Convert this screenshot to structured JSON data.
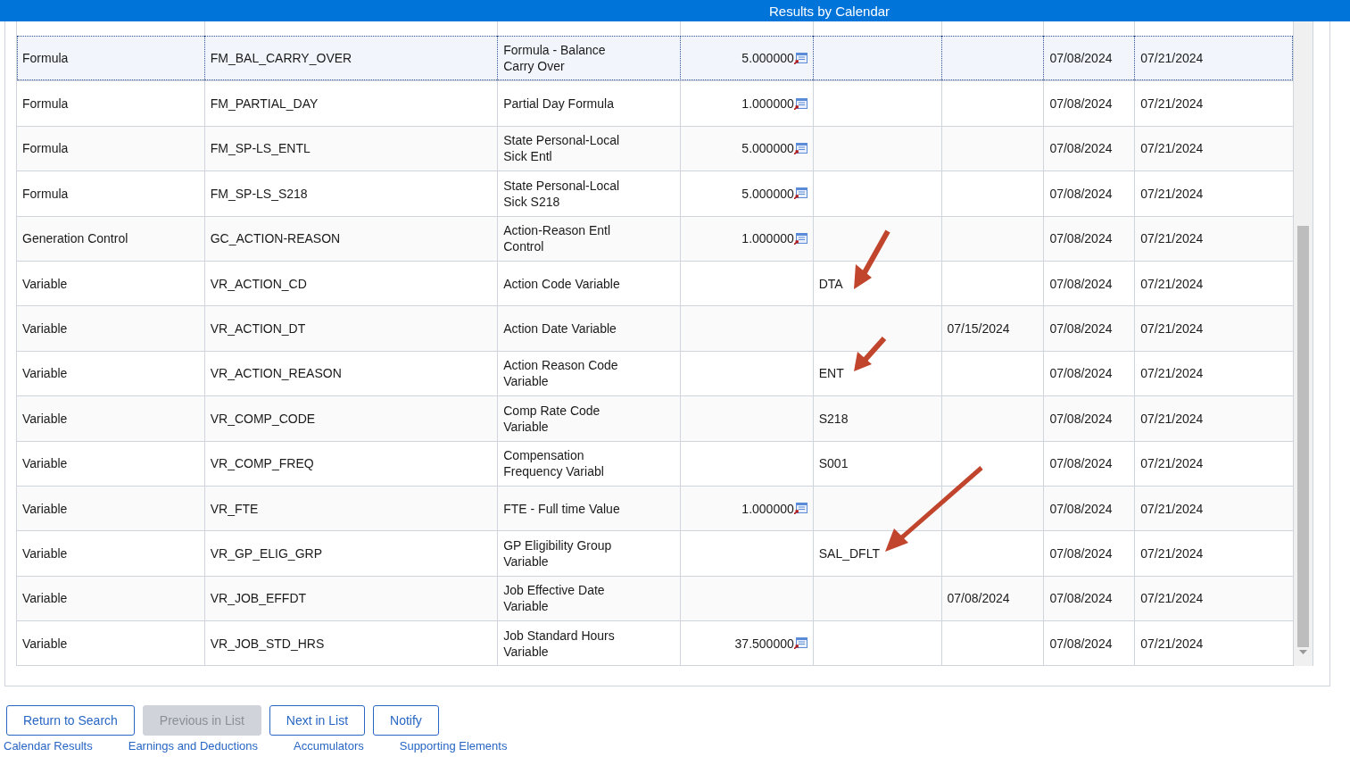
{
  "header": {
    "title": "Results by Calendar"
  },
  "rows": [
    {
      "selected": true,
      "cells": [
        "Formula",
        "FM_BAL_CARRY_OVER",
        "Formula - Balance Carry Over",
        "5.000000",
        "",
        "",
        "07/08/2024",
        "07/21/2024"
      ]
    },
    {
      "selected": false,
      "cells": [
        "Formula",
        "FM_PARTIAL_DAY",
        "Partial Day Formula",
        "1.000000",
        "",
        "",
        "07/08/2024",
        "07/21/2024"
      ]
    },
    {
      "selected": false,
      "cells": [
        "Formula",
        "FM_SP-LS_ENTL",
        "State Personal-Local Sick Entl",
        "5.000000",
        "",
        "",
        "07/08/2024",
        "07/21/2024"
      ]
    },
    {
      "selected": false,
      "cells": [
        "Formula",
        "FM_SP-LS_S218",
        "State Personal-Local Sick S218",
        "5.000000",
        "",
        "",
        "07/08/2024",
        "07/21/2024"
      ]
    },
    {
      "selected": false,
      "cells": [
        "Generation Control",
        "GC_ACTION-REASON",
        "Action-Reason Entl Control",
        "1.000000",
        "",
        "",
        "07/08/2024",
        "07/21/2024"
      ]
    },
    {
      "selected": false,
      "cells": [
        "Variable",
        "VR_ACTION_CD",
        "Action Code Variable",
        "",
        "DTA",
        "",
        "07/08/2024",
        "07/21/2024"
      ]
    },
    {
      "selected": false,
      "cells": [
        "Variable",
        "VR_ACTION_DT",
        "Action Date Variable",
        "",
        "",
        "07/15/2024",
        "07/08/2024",
        "07/21/2024"
      ]
    },
    {
      "selected": false,
      "cells": [
        "Variable",
        "VR_ACTION_REASON",
        "Action Reason Code Variable",
        "",
        "ENT",
        "",
        "07/08/2024",
        "07/21/2024"
      ]
    },
    {
      "selected": false,
      "cells": [
        "Variable",
        "VR_COMP_CODE",
        "Comp Rate Code Variable",
        "",
        "S218",
        "",
        "07/08/2024",
        "07/21/2024"
      ]
    },
    {
      "selected": false,
      "cells": [
        "Variable",
        "VR_COMP_FREQ",
        "Compensation Frequency Variabl",
        "",
        "S001",
        "",
        "07/08/2024",
        "07/21/2024"
      ]
    },
    {
      "selected": false,
      "cells": [
        "Variable",
        "VR_FTE",
        "FTE - Full time Value",
        "1.000000",
        "",
        "",
        "07/08/2024",
        "07/21/2024"
      ]
    },
    {
      "selected": false,
      "cells": [
        "Variable",
        "VR_GP_ELIG_GRP",
        "GP Eligibility Group Variable",
        "",
        "SAL_DFLT",
        "",
        "07/08/2024",
        "07/21/2024"
      ]
    },
    {
      "selected": false,
      "cells": [
        "Variable",
        "VR_JOB_EFFDT",
        "Job Effective Date Variable",
        "",
        "",
        "07/08/2024",
        "07/08/2024",
        "07/21/2024"
      ]
    },
    {
      "selected": false,
      "cells": [
        "Variable",
        "VR_JOB_STD_HRS",
        "Job Standard Hours Variable",
        "37.500000",
        "",
        "",
        "07/08/2024",
        "07/21/2024"
      ]
    }
  ],
  "buttons": [
    {
      "label": "Return to Search",
      "disabled": false
    },
    {
      "label": "Previous in List",
      "disabled": true
    },
    {
      "label": "Next in List",
      "disabled": false
    },
    {
      "label": "Notify",
      "disabled": false
    }
  ],
  "links": [
    "Calendar Results",
    "Earnings and Deductions",
    "Accumulators",
    "Supporting Elements"
  ]
}
